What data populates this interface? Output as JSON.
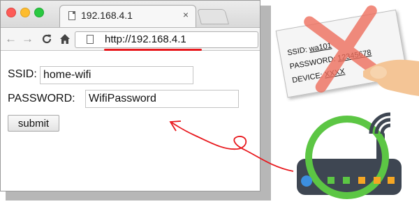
{
  "browser": {
    "tab_title": "192.168.4.1",
    "tab_close": "×",
    "url": "http://192.168.4.1",
    "nav": {
      "back": "←",
      "forward": "→",
      "reload": "C",
      "home": "⌂"
    }
  },
  "form": {
    "ssid_label": "SSID:",
    "ssid_value": "home-wifi",
    "password_label": "PASSWORD:",
    "password_value": "WifiPassword",
    "submit_label": "submit"
  },
  "card": {
    "ssid_label": "SSID: ",
    "ssid_value": "wa101",
    "password_label": "PASSWORD: ",
    "password_value": "12345678",
    "device_label": "DEVICE: ",
    "device_value": "XXXX"
  },
  "colors": {
    "highlight_red": "#e8171c",
    "router_green": "#5cc644",
    "router_body": "#3e4652",
    "router_port_blue": "#3c8fe0",
    "router_port_orange": "#f5a623"
  },
  "icons": [
    "close-icon",
    "back-arrow-icon",
    "forward-arrow-icon",
    "reload-icon",
    "home-icon",
    "document-icon",
    "router-icon",
    "wifi-signal-icon",
    "hand-pointer-icon",
    "cross-mark-icon"
  ]
}
